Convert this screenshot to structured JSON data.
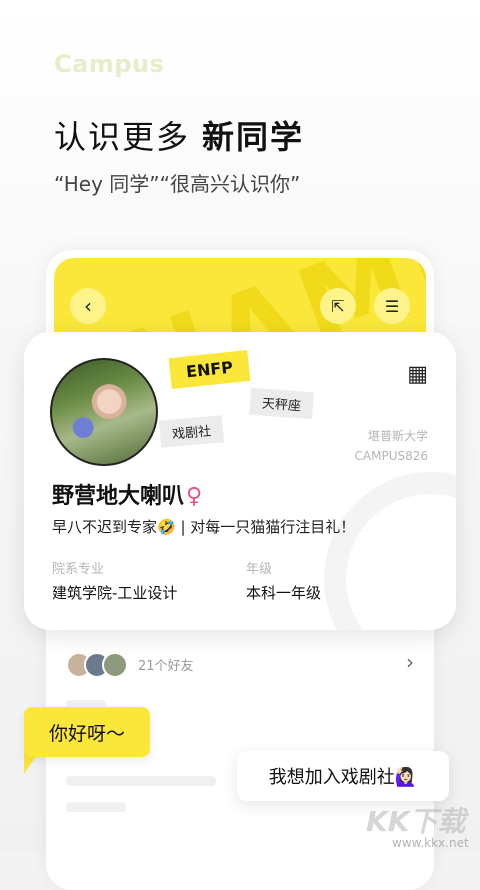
{
  "brand": "Campus",
  "headline": {
    "regular": "认识更多",
    "bold": "新同学"
  },
  "subline": "“Hey 同学”“很高兴认识你”",
  "header_icons": {
    "back": "chevron-left-icon",
    "share": "share-icon",
    "menu": "menu-icon"
  },
  "profile": {
    "tags": {
      "mbti": "ENFP",
      "zodiac": "天秤座",
      "club": "戏剧社"
    },
    "school_name": "堪普斯大学",
    "school_id": "CAMPUS826",
    "name": "野营地大喇叭",
    "gender_symbol": "♀",
    "bio": "早八不迟到专家🤣 | 对每一只猫猫行注目礼！",
    "major_label": "院系专业",
    "major_value": "建筑学院-工业设计",
    "grade_label": "年级",
    "grade_value": "本科一年级"
  },
  "friends": {
    "count_text": "21个好友"
  },
  "bubbles": {
    "left": "你好呀～",
    "right": "我想加入戏剧社🙋🏻‍♀️"
  },
  "watermark": {
    "logo": "KK下载",
    "url": "www.kkx.net"
  },
  "colors": {
    "accent": "#fae73a",
    "gender": "#e8528a"
  }
}
